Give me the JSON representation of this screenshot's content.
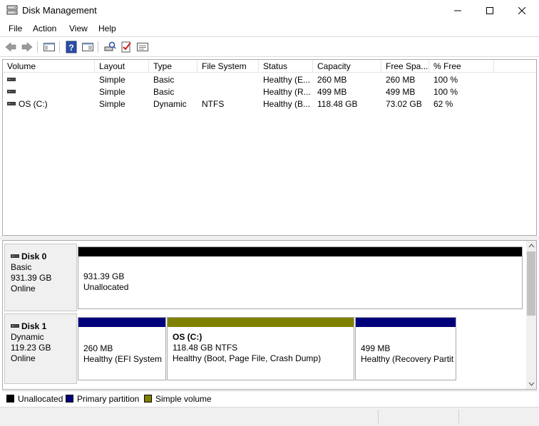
{
  "window": {
    "title": "Disk Management",
    "controls": {
      "minimize": "—",
      "maximize": "☐",
      "close": "✕"
    }
  },
  "menu": [
    "File",
    "Action",
    "View",
    "Help"
  ],
  "toolbar": {
    "icons": [
      "back-arrow-icon",
      "forward-arrow-icon",
      "console-tree-icon",
      "help-icon",
      "action-pane-icon",
      "rescan-disks-icon",
      "check-icon",
      "properties-icon"
    ]
  },
  "volume_list": {
    "columns": [
      "Volume",
      "Layout",
      "Type",
      "File System",
      "Status",
      "Capacity",
      "Free Spa...",
      "% Free"
    ],
    "rows": [
      {
        "volume": "",
        "layout": "Simple",
        "type": "Basic",
        "fs": "",
        "status": "Healthy (E...",
        "capacity": "260 MB",
        "free": "260 MB",
        "pct": "100 %"
      },
      {
        "volume": "",
        "layout": "Simple",
        "type": "Basic",
        "fs": "",
        "status": "Healthy (R...",
        "capacity": "499 MB",
        "free": "499 MB",
        "pct": "100 %"
      },
      {
        "volume": "OS (C:)",
        "layout": "Simple",
        "type": "Dynamic",
        "fs": "NTFS",
        "status": "Healthy (B...",
        "capacity": "118.48 GB",
        "free": "73.02 GB",
        "pct": "62 %"
      }
    ]
  },
  "disks": [
    {
      "name": "Disk 0",
      "kind": "Basic",
      "size": "931.39 GB",
      "state": "Online",
      "partitions": [
        {
          "title": "",
          "line1": "931.39 GB",
          "line2": "Unallocated",
          "color": "#000000"
        }
      ]
    },
    {
      "name": "Disk 1",
      "kind": "Dynamic",
      "size": "119.23 GB",
      "state": "Online",
      "partitions": [
        {
          "title": "",
          "line1": "260 MB",
          "line2": "Healthy (EFI System P",
          "color": "#00007a"
        },
        {
          "title": "OS  (C:)",
          "line1": "118.48 GB NTFS",
          "line2": "Healthy (Boot, Page File, Crash Dump)",
          "color": "#808000"
        },
        {
          "title": "",
          "line1": "499 MB",
          "line2": "Healthy (Recovery Partit",
          "color": "#00007a"
        }
      ]
    }
  ],
  "legend": [
    {
      "label": "Unallocated",
      "color": "#000000"
    },
    {
      "label": "Primary partition",
      "color": "#00007a"
    },
    {
      "label": "Simple volume",
      "color": "#808000"
    }
  ]
}
